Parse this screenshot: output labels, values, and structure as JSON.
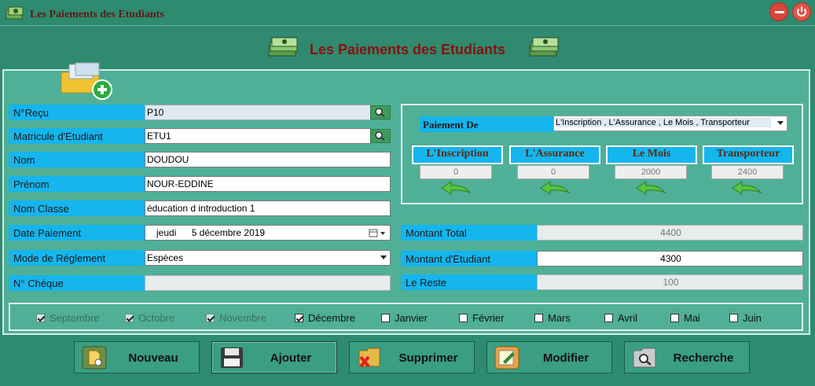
{
  "window": {
    "title": "Les Paiements des Etudiants"
  },
  "header": {
    "title": "Les Paiements des Etudiants"
  },
  "form": {
    "recu": {
      "label": "N°Reçu",
      "value": "P10"
    },
    "matricule": {
      "label": "Matricule d'Etudiant",
      "value": "ETU1"
    },
    "nom": {
      "label": "Nom",
      "value": "DOUDOU"
    },
    "prenom": {
      "label": "Prénom",
      "value": "NOUR-EDDINE"
    },
    "classe": {
      "label": "Nom Classe",
      "value": "éducation d introduction 1"
    },
    "date": {
      "label": "Date Paiement",
      "day": "jeudi",
      "value": "5 décembre 2019"
    },
    "mode": {
      "label": "Mode de Réglement",
      "value": "Espèces"
    },
    "cheque": {
      "label": "N° Chéque",
      "value": ""
    }
  },
  "payment": {
    "type_label": "Paiement De",
    "type_value": "L'Inscription , L'Assurance , Le Mois , Transporteur",
    "categories": [
      {
        "label": "L'Inscription",
        "value": "0"
      },
      {
        "label": "L'Assurance",
        "value": "0"
      },
      {
        "label": "Le Mois",
        "value": "2000"
      },
      {
        "label": "Transporteur",
        "value": "2400"
      }
    ]
  },
  "totals": {
    "total": {
      "label": "Montant Total",
      "value": "4400"
    },
    "etudiant": {
      "label": "Montant d'Etudiant",
      "value": "4300"
    },
    "reste": {
      "label": "Le Reste",
      "value": "100"
    }
  },
  "months": [
    {
      "label": "Septembre",
      "checked": true,
      "enabled": false
    },
    {
      "label": "Octobre",
      "checked": true,
      "enabled": false
    },
    {
      "label": "Novembre",
      "checked": true,
      "enabled": false
    },
    {
      "label": "Décembre",
      "checked": true,
      "enabled": true
    },
    {
      "label": "Janvier",
      "checked": false,
      "enabled": true
    },
    {
      "label": "Février",
      "checked": false,
      "enabled": true
    },
    {
      "label": "Mars",
      "checked": false,
      "enabled": true
    },
    {
      "label": "Avril",
      "checked": false,
      "enabled": true
    },
    {
      "label": "Mai",
      "checked": false,
      "enabled": true
    },
    {
      "label": "Juin",
      "checked": false,
      "enabled": true
    }
  ],
  "buttons": {
    "nouveau": "Nouveau",
    "ajouter": "Ajouter",
    "supprimer": "Supprimer",
    "modifier": "Modifier",
    "recherche": "Recherche"
  },
  "colors": {
    "background": "#2e8b6f",
    "panel": "#4fb097",
    "label_blue": "#15b5ee",
    "title_red": "#8b0f0f"
  }
}
